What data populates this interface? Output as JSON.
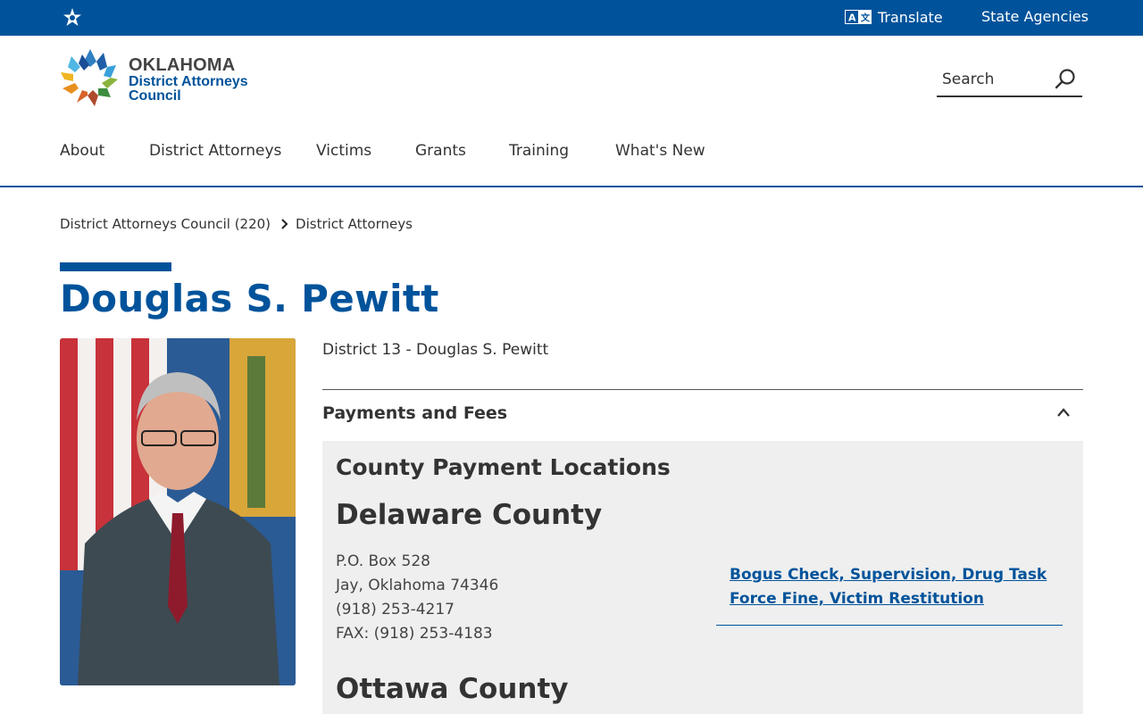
{
  "topbar": {
    "translate_label": "Translate",
    "agencies_label": "State Agencies"
  },
  "logo": {
    "line1": "OKLAHOMA",
    "line2": "District Attorneys",
    "line3": "Council"
  },
  "search": {
    "label": "Search"
  },
  "nav": {
    "items": [
      "About",
      "District Attorneys",
      "Victims",
      "Grants",
      "Training",
      "What's New"
    ]
  },
  "breadcrumb": {
    "items": [
      "District Attorneys Council (220)",
      "District Attorneys"
    ]
  },
  "page": {
    "title": "Douglas S. Pewitt",
    "district": "District 13 - Douglas S. Pewitt"
  },
  "accordion": {
    "title": "Payments and Fees",
    "section_title": "County Payment Locations",
    "counties": [
      {
        "name": "Delaware County",
        "address": [
          "P.O. Box 528",
          "Jay, Oklahoma 74346",
          "(918) 253-4217",
          "FAX: (918) 253-4183"
        ],
        "link_lines": [
          "Bogus Check, Supervision, Drug Task",
          "Force Fine, Victim Restitution"
        ]
      },
      {
        "name": "Ottawa County"
      }
    ]
  },
  "colors": {
    "brand_blue": "#00539b",
    "panel_bg": "#efefef"
  }
}
